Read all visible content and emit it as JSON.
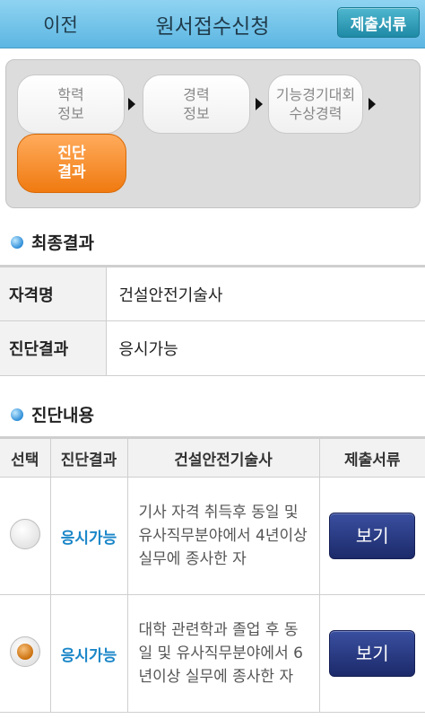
{
  "header": {
    "back_label": "이전",
    "title": "원서접수신청",
    "submit_label": "제출서류"
  },
  "steps": [
    {
      "label": "학력\n정보",
      "active": false
    },
    {
      "label": "경력\n정보",
      "active": false
    },
    {
      "label": "기능경기대회\n수상경력",
      "active": false
    },
    {
      "label": "진단\n결과",
      "active": true
    }
  ],
  "final_result": {
    "heading": "최종결과",
    "rows": [
      {
        "label": "자격명",
        "value": "건설안전기술사"
      },
      {
        "label": "진단결과",
        "value": "응시가능"
      }
    ]
  },
  "diagnosis": {
    "heading": "진단내용",
    "columns": [
      "선택",
      "진단결과",
      "건설안전기술사",
      "제출서류"
    ],
    "rows": [
      {
        "selected": false,
        "result": "응시가능",
        "description": "기사 자격 취득후 동일 및 유사직무분야에서 4년이상 실무에 종사한 자",
        "button": "보기"
      },
      {
        "selected": true,
        "result": "응시가능",
        "description": "대학 관련학과 졸업 후 동일 및 유사직무분야에서 6년이상 실무에 종사한 자",
        "button": "보기"
      }
    ]
  },
  "colors": {
    "header_bg": "#6cc1e8",
    "active_step": "#f5892a",
    "result_text": "#1a86c8",
    "view_button": "#26367f"
  }
}
